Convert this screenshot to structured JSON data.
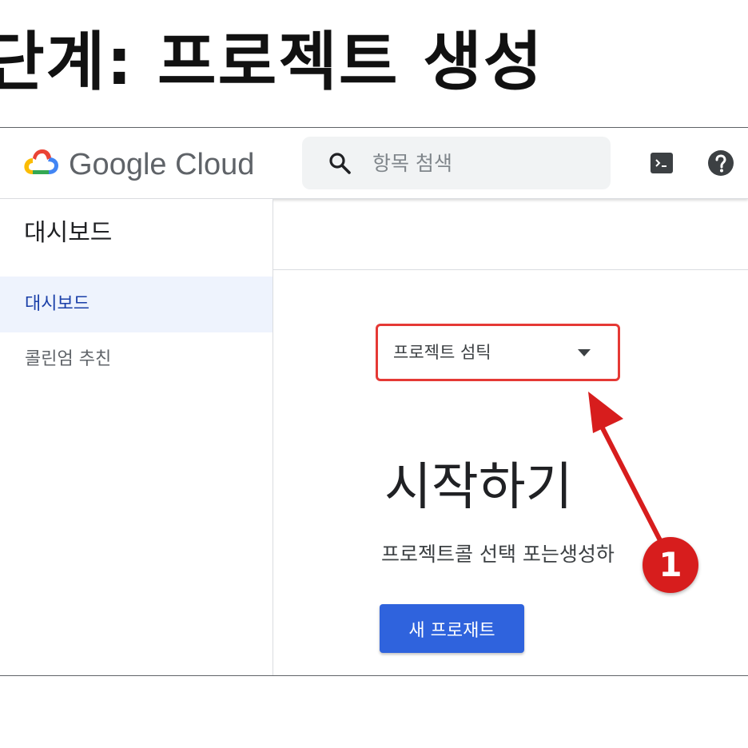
{
  "slide": {
    "title": "단계: 프로젝트 생성"
  },
  "header": {
    "brand": "Google Cloud",
    "search": {
      "placeholder": "항목 첨색",
      "value": ""
    },
    "icons": [
      "google-cloud-logo-icon",
      "search-icon",
      "terminal-icon",
      "help-icon"
    ]
  },
  "sidebar": {
    "title": "대시보드",
    "items": [
      {
        "label": "대시보드",
        "active": true
      },
      {
        "label": "콜린엄 추친",
        "active": false
      }
    ]
  },
  "main": {
    "project_selector": {
      "label": "프로젝트 섬틱"
    },
    "headline": "시작하기",
    "subtext": "프로젝트콜 선택 포는생성하",
    "new_project_button": "새 프로재트"
  },
  "annotation": {
    "number": "1",
    "color": "#d71d1d"
  },
  "colors": {
    "primary_button": "#2f63dd",
    "highlight_border": "#e53935",
    "active_nav_bg": "#eef3fd",
    "active_nav_text": "#1a3fa8"
  }
}
